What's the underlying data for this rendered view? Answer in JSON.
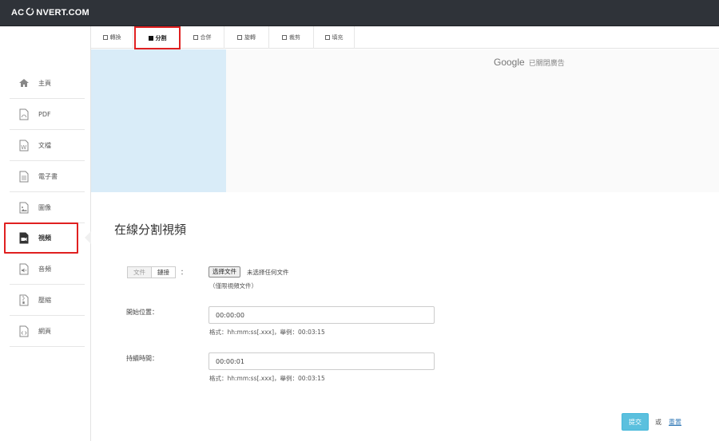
{
  "app": {
    "logo_left": "AC",
    "logo_right": "NVERT.COM"
  },
  "tabs": [
    {
      "label": "轉換",
      "active": false
    },
    {
      "label": "分割",
      "active": true
    },
    {
      "label": "合併",
      "active": false
    },
    {
      "label": "旋轉",
      "active": false
    },
    {
      "label": "裁剪",
      "active": false
    },
    {
      "label": "填充",
      "active": false
    }
  ],
  "sidebar": {
    "items": [
      {
        "label": "主頁",
        "icon": "home-icon"
      },
      {
        "label": "PDF",
        "icon": "pdf-file-icon"
      },
      {
        "label": "文檔",
        "icon": "word-file-icon"
      },
      {
        "label": "電子書",
        "icon": "ebook-icon"
      },
      {
        "label": "圖像",
        "icon": "image-file-icon"
      },
      {
        "label": "視頻",
        "icon": "video-file-icon",
        "active": true
      },
      {
        "label": "音頻",
        "icon": "audio-file-icon"
      },
      {
        "label": "壓縮",
        "icon": "archive-file-icon"
      },
      {
        "label": "網頁",
        "icon": "code-file-icon"
      }
    ]
  },
  "ad": {
    "google": "Google",
    "closed": "已關閉廣告"
  },
  "main": {
    "title": "在線分割視頻",
    "source": {
      "file_option": "文件",
      "link_option": "鏈接",
      "colon": "：",
      "choose_button": "选择文件",
      "no_file": "未选择任何文件",
      "hint": "（僅限視頻文件）"
    },
    "start": {
      "label": "開始位置：",
      "value": "00:00:00",
      "hint": "格式：hh:mm:ss[.xxx]，舉例：00:03:15"
    },
    "duration": {
      "label": "持續時間：",
      "value": "00:00:01",
      "hint": "格式：hh:mm:ss[.xxx]，舉例：00:03:15"
    },
    "submit": "提交",
    "or": "或",
    "reset": "重置"
  },
  "colors": {
    "topbar": "#2f3339",
    "highlight": "#e02020",
    "submit": "#5bc0de",
    "link": "#337ab7",
    "ad_left": "#d9ecf8"
  }
}
